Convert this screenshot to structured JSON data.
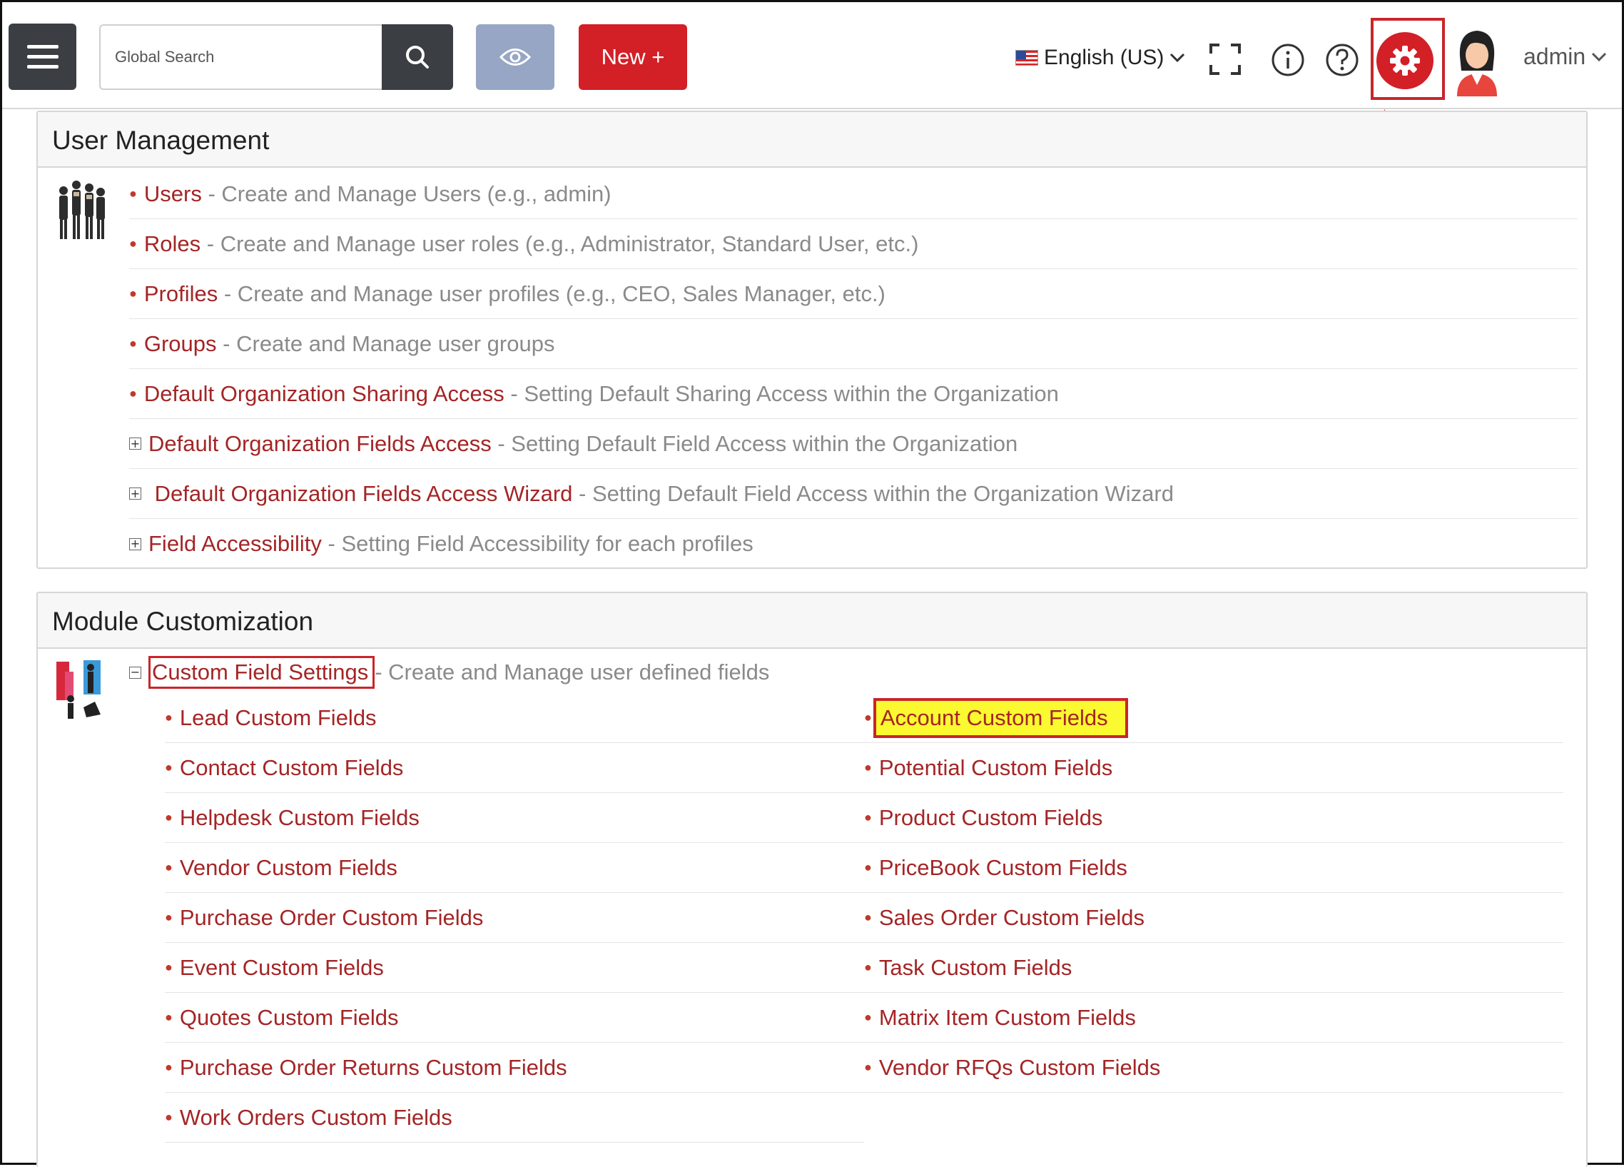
{
  "header": {
    "search_placeholder": "Global Search",
    "new_label": "New +",
    "language": "English (US)",
    "user": "admin"
  },
  "user_management": {
    "title": "User Management",
    "items": [
      {
        "label": "Users",
        "desc": "- Create and Manage Users (e.g., admin)"
      },
      {
        "label": "Roles",
        "desc": "- Create and Manage user roles (e.g., Administrator, Standard User, etc.)"
      },
      {
        "label": "Profiles",
        "desc": "- Create and Manage user profiles (e.g., CEO, Sales Manager, etc.)"
      },
      {
        "label": "Groups",
        "desc": "- Create and Manage user groups"
      },
      {
        "label": "Default Organization Sharing Access",
        "desc": "- Setting Default Sharing Access within the Organization"
      },
      {
        "label": "Default Organization Fields Access",
        "desc": "- Setting Default Field Access within the Organization"
      },
      {
        "label": "Default Organization Fields Access Wizard",
        "desc": "- Setting Default Field Access within the Organization Wizard"
      },
      {
        "label": "Field Accessibility",
        "desc": "- Setting Field Accessibility for each profiles"
      }
    ]
  },
  "module_customization": {
    "title": "Module Customization",
    "custom_field_settings": {
      "label": "Custom Field Settings",
      "desc": "- Create and Manage user defined fields"
    },
    "left_fields": [
      "Lead Custom Fields",
      "Contact Custom Fields",
      "Helpdesk Custom Fields",
      "Vendor Custom Fields",
      "Purchase Order Custom Fields",
      "Event Custom Fields",
      "Quotes Custom Fields",
      "Purchase Order Returns Custom Fields",
      "Work Orders Custom Fields"
    ],
    "right_fields": [
      "Account Custom Fields",
      "Potential Custom Fields",
      "Product Custom Fields",
      "PriceBook Custom Fields",
      "Sales Order Custom Fields",
      "Task Custom Fields",
      "Matrix Item Custom Fields",
      "Vendor RFQs Custom Fields"
    ]
  },
  "colors": {
    "link": "#a42526",
    "accent_red": "#d31f26",
    "highlight": "#fbf92f",
    "dark_button": "#3b3e42",
    "eye_button": "#97a6c4"
  }
}
